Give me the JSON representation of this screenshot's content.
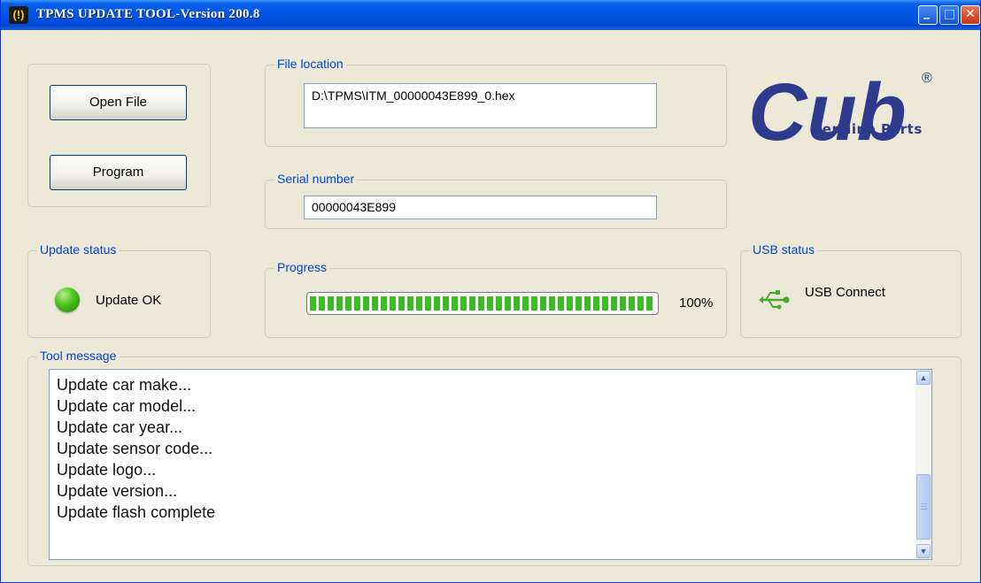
{
  "window": {
    "title": "TPMS UPDATE TOOL-Version 200.8",
    "app_icon": "(!)",
    "minimize_icon": "_",
    "maximize_icon": "□",
    "close_icon": "✕"
  },
  "actions": {
    "open_file_label": "Open File",
    "program_label": "Program"
  },
  "file_location": {
    "legend": "File location",
    "value": "D:\\TPMS\\ITM_00000043E899_0.hex"
  },
  "serial_number": {
    "legend": "Serial number",
    "value": "00000043E899"
  },
  "logo": {
    "brand": "Cub",
    "tagline": "Genuine Parts",
    "registered": "®"
  },
  "update_status": {
    "legend": "Update status",
    "text": "Update OK",
    "indicator_color": "#48c21a"
  },
  "progress": {
    "legend": "Progress",
    "percent_label": "100%",
    "value": 1.0,
    "bar_color": "#3dbb24"
  },
  "usb_status": {
    "legend": "USB status",
    "text": "USB Connect",
    "icon": "usb-icon"
  },
  "tool_message": {
    "legend": "Tool message",
    "lines": [
      "Update car make...",
      "Update car model...",
      "Update car year...",
      "Update sensor code...",
      "Update logo...",
      "Update version...",
      "Update flash complete"
    ]
  },
  "colors": {
    "legend_text": "#0046d5",
    "titlebar": "#0055e5",
    "logo_blue": "#2e3a8c"
  }
}
